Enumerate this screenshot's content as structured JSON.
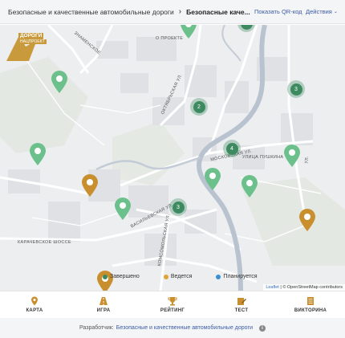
{
  "header": {
    "breadcrumb_parent": "Безопасные и качественные автомобильные дороги",
    "breadcrumb_current": "Безопасные каче...",
    "qr_label": "Показать QR-код",
    "actions_label": "Действия"
  },
  "map": {
    "logo_line1": "ДОРОГИ",
    "logo_line2": "НАЦПРОЕКТ",
    "streets": {
      "about": "О ПРОЕКТЕ",
      "oktyabrskaya": "ОКТЯБРЬСКАЯ УЛ.",
      "moskovskaya": "МОСКОВСКАЯ УЛ.",
      "pushkina": "УЛИЦА ПУШКИНА",
      "vasilyevskaya": "ВАСИЛЬЕВСКАЯ УЛ.",
      "karachevskoe": "КАРАЧЕВСКОЕ ШОССЕ",
      "komsomolskaya": "КОМСОМОЛЬСКАЯ УЛ.",
      "znamenskoe": "ЗНАМЕНСКОЕ",
      "right_road": "УЛ."
    },
    "clusters": {
      "c1": "2",
      "c2": "3",
      "c3": "4",
      "c4": "3"
    },
    "legend": {
      "completed": "Завершено",
      "in_progress": "Ведется",
      "planned": "Планируется"
    },
    "legend_colors": {
      "completed": "#3e8a60",
      "in_progress": "#e0a43a",
      "planned": "#3a8fd6"
    },
    "attribution_leaflet": "Leaflet",
    "attribution_rest": " | © OpenStreetMap contributors"
  },
  "tabs": [
    {
      "label": "КАРТА",
      "icon": "map-pin-icon"
    },
    {
      "label": "ИГРА",
      "icon": "road-icon"
    },
    {
      "label": "РЕЙТИНГ",
      "icon": "trophy-icon"
    },
    {
      "label": "ТЕСТ",
      "icon": "edit-icon"
    },
    {
      "label": "ВИКТОРИНА",
      "icon": "quiz-icon"
    }
  ],
  "footer": {
    "developer_label": "Разработчик:",
    "developer_link": "Безопасные и качественные автомобильные дороги",
    "info_glyph": "i"
  },
  "colors": {
    "accent": "#3b5ba5",
    "pin_green": "#6cc08b",
    "pin_orange": "#c98f2f",
    "cluster": "#3e8a60"
  }
}
